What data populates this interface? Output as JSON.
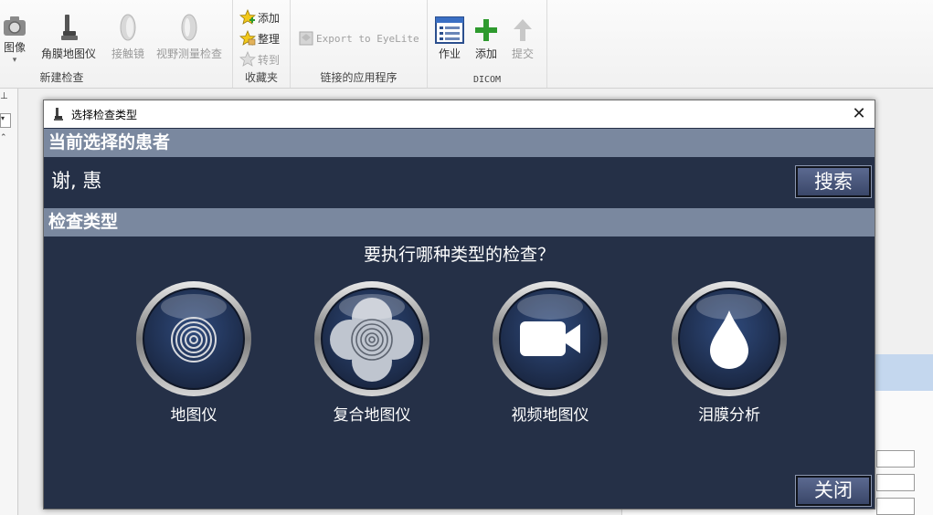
{
  "ribbon": {
    "groups": {
      "new_exam": {
        "label": "新建检查",
        "camera_label": "图像",
        "topography_label": "角膜地图仪",
        "contact_lens_label": "接触镜",
        "perimetry_label": "视野测量检查"
      },
      "favorites": {
        "label": "收藏夹",
        "add_label": "添加",
        "organize_label": "整理",
        "goto_label": "转到"
      },
      "linked_apps": {
        "label": "链接的应用程序",
        "export_label": "Export to EyeLite"
      },
      "dicom": {
        "label": "DICOM",
        "job_label": "作业",
        "add_label": "添加",
        "submit_label": "提交"
      }
    }
  },
  "dialog": {
    "title": "选择检查类型",
    "patient_section": {
      "header": "当前选择的患者",
      "patient_name": "谢, 惠",
      "search_label": "搜索"
    },
    "exam_section": {
      "header": "检查类型",
      "question": "要执行哪种类型的检查？",
      "types": [
        {
          "label": "地图仪",
          "icon": "rings-icon"
        },
        {
          "label": "复合地图仪",
          "icon": "composite-rings-icon"
        },
        {
          "label": "视频地图仪",
          "icon": "video-camera-icon"
        },
        {
          "label": "泪膜分析",
          "icon": "tear-drop-icon"
        }
      ]
    },
    "close_label": "关闭"
  },
  "colors": {
    "dialog_bg": "#253047",
    "section_header_bg": "#7a889f",
    "dicom_add_green": "#2e9a2e"
  }
}
